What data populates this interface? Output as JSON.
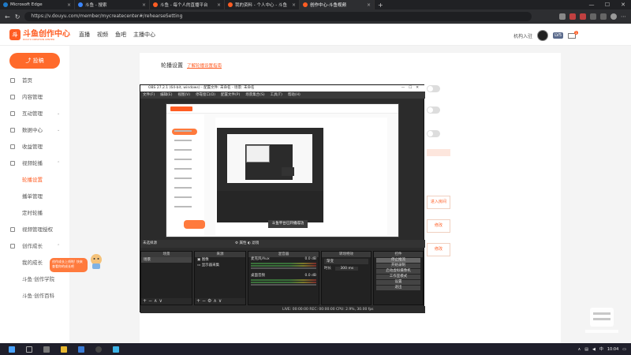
{
  "browser": {
    "tabs": [
      {
        "label": "Microsoft Edge",
        "icon": "edge-icon",
        "color": "#1f7ac8",
        "active": false
      },
      {
        "label": "斗鱼 - 搜索",
        "icon": "search-icon",
        "color": "#3a86ff",
        "active": false
      },
      {
        "label": "斗鱼 - 每个人的直播平台",
        "icon": "douyu-icon",
        "color": "#ff5d23",
        "active": false
      },
      {
        "label": "我的资料 - 个人中心 - 斗鱼",
        "icon": "douyu-icon",
        "color": "#ff5d23",
        "active": false
      },
      {
        "label": "创作中心-斗鱼视频",
        "icon": "douyu-icon",
        "color": "#ff5d23",
        "active": true
      }
    ],
    "new_tab": "+",
    "window_controls": [
      "—",
      "☐",
      "✕"
    ],
    "url": "https://v.douyu.com/member/mycreatecenter#/rehearseSetting"
  },
  "site": {
    "logo_text": "斗鱼创作中心",
    "logo_sub": "DOUYU CREATION CENTER",
    "nav": [
      "直播",
      "视频",
      "鱼吧",
      "主播中心"
    ],
    "user": {
      "link": "机构入驻",
      "level": "LV5",
      "mail_count": "1"
    }
  },
  "sidebar": {
    "start_button": "投稿",
    "items": [
      {
        "label": "首页",
        "icon": "home-icon",
        "has_arrow": false
      },
      {
        "label": "内容管理",
        "icon": "content-icon",
        "has_arrow": false
      },
      {
        "label": "互动管理",
        "icon": "interaction-icon",
        "has_arrow": true
      },
      {
        "label": "数据中心",
        "icon": "data-icon",
        "has_arrow": true
      },
      {
        "label": "收益管理",
        "icon": "income-icon",
        "has_arrow": false
      },
      {
        "label": "视频轮播",
        "icon": "carousel-icon",
        "has_arrow": true
      },
      {
        "label": "轮播设置",
        "sub": true,
        "selected": true
      },
      {
        "label": "播单管理",
        "sub": true
      },
      {
        "label": "定时轮播",
        "sub": true
      },
      {
        "label": "视频管理授权",
        "icon": "auth-icon",
        "has_arrow": false
      },
      {
        "label": "创作成长",
        "icon": "growth-icon",
        "has_arrow": true
      },
      {
        "label": "我的成长",
        "sub": true
      },
      {
        "label": "斗鱼·创作学院",
        "sub": true
      },
      {
        "label": "斗鱼·创作百科",
        "sub": true
      }
    ],
    "promo_text": "创作成长上线啦! 快来查看你的成长吧"
  },
  "content": {
    "title": "轮播设置",
    "link": "了解轮播设置指南",
    "side_buttons": [
      "进入房间",
      "修改",
      "修改"
    ]
  },
  "obs": {
    "title": "OBS 27.2.1 (64-bit, windows) - 配置文件: 未命名 - 场景: 未命名",
    "menu": [
      "文件(F)",
      "编辑(E)",
      "视图(V)",
      "停靠窗口(D)",
      "配置文件(P)",
      "场景集合(S)",
      "工具(T)",
      "帮助(H)"
    ],
    "preview_toast": "斗鱼平台已开播成功",
    "source_bar": {
      "left": "未选择源",
      "props": "属性",
      "filters": "滤镜"
    },
    "scenes": {
      "header": "场景",
      "items": [
        "场景"
      ]
    },
    "sources": {
      "header": "来源",
      "items": [
        "图像",
        "显示器采集"
      ]
    },
    "mixer": {
      "header": "混音器",
      "tracks": [
        {
          "name": "麦克风/Aux",
          "level": "0.0 dB"
        },
        {
          "name": "桌面音频",
          "level": "0.0 dB"
        }
      ]
    },
    "transitions": {
      "header": "转场特效",
      "type": "渐变",
      "duration_label": "时长",
      "duration": "300 ms"
    },
    "controls": {
      "header": "控件",
      "buttons": [
        "停止推流",
        "开始录制",
        "启动虚拟摄像机",
        "工作室模式",
        "设置",
        "退出"
      ]
    },
    "status": "LIVE: 00:00:00   REC: 00:00:00   CPU: 2.9%, 30.00 fps"
  },
  "taskbar": {
    "time": "10:04",
    "date": "",
    "lang": "中"
  }
}
